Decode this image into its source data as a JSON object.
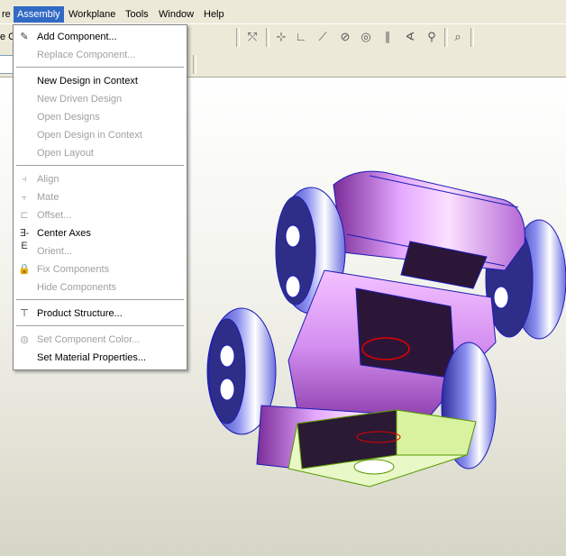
{
  "menubar": {
    "items": [
      {
        "label": "re",
        "active": false
      },
      {
        "label": "Assembly",
        "active": true
      },
      {
        "label": "Workplane",
        "active": false
      },
      {
        "label": "Tools",
        "active": false
      },
      {
        "label": "Window",
        "active": false
      },
      {
        "label": "Help",
        "active": false
      }
    ]
  },
  "left_edge_text": "e C",
  "assembly_menu": {
    "items": [
      {
        "label": "Add Component...",
        "enabled": true,
        "icon": "add-component-icon"
      },
      {
        "label": "Replace Component...",
        "enabled": false
      },
      {
        "label": "New Design in Context",
        "enabled": true
      },
      {
        "label": "New Driven Design",
        "enabled": false
      },
      {
        "label": "Open Designs",
        "enabled": false
      },
      {
        "label": "Open Design in Context",
        "enabled": false
      },
      {
        "label": "Open Layout",
        "enabled": false
      },
      {
        "label": "Align",
        "enabled": false,
        "icon": "align-icon"
      },
      {
        "label": "Mate",
        "enabled": false,
        "icon": "mate-icon"
      },
      {
        "label": "Offset...",
        "enabled": false,
        "icon": "offset-icon"
      },
      {
        "label": "Center Axes",
        "enabled": true,
        "icon": "center-axes-icon"
      },
      {
        "label": "Orient...",
        "enabled": false
      },
      {
        "label": "Fix Components",
        "enabled": false,
        "icon": "fix-components-icon"
      },
      {
        "label": "Hide Components",
        "enabled": false
      },
      {
        "label": "Product Structure...",
        "enabled": true,
        "icon": "product-structure-icon"
      },
      {
        "label": "Set Component Color...",
        "enabled": false,
        "icon": "component-color-icon"
      },
      {
        "label": "Set Material Properties...",
        "enabled": true
      }
    ]
  },
  "colors": {
    "menu_highlight": "#316ac5",
    "body_purple": "#d38ef0",
    "wheel_blue": "#6a6fe0",
    "edge_blue": "#1c1cb4",
    "selected_face": "#d9f2a0",
    "selection_edge": "#e00000"
  }
}
